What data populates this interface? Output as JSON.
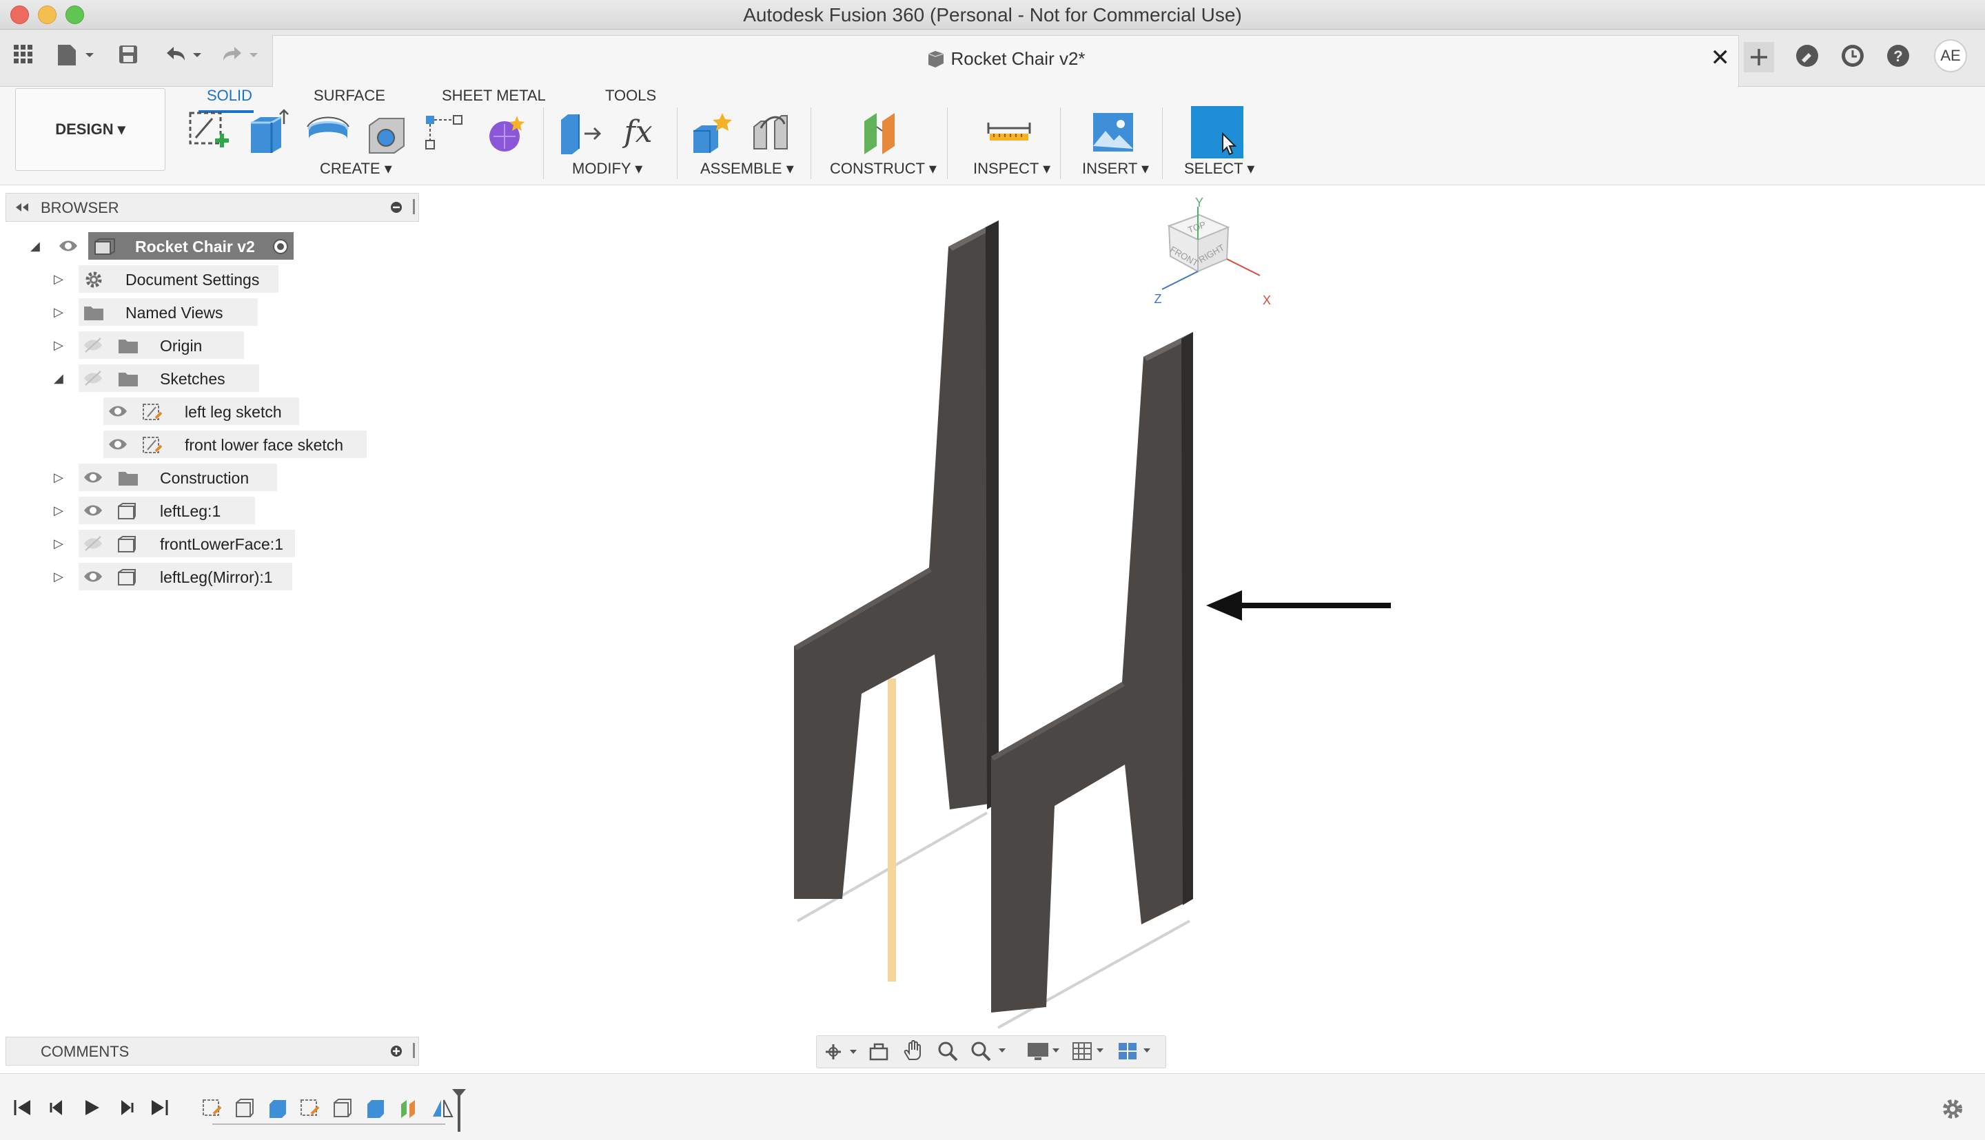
{
  "window": {
    "title": "Autodesk Fusion 360 (Personal - Not for Commercial Use)"
  },
  "document": {
    "title": "Rocket Chair v2*"
  },
  "user": {
    "initials": "AE"
  },
  "workspace": {
    "label": "DESIGN"
  },
  "tabs": [
    {
      "label": "SOLID",
      "active": true
    },
    {
      "label": "SURFACE"
    },
    {
      "label": "SHEET METAL"
    },
    {
      "label": "TOOLS"
    }
  ],
  "toolbar_groups": {
    "create": "CREATE",
    "modify": "MODIFY",
    "assemble": "ASSEMBLE",
    "construct": "CONSTRUCT",
    "inspect": "INSPECT",
    "insert": "INSERT",
    "select": "SELECT"
  },
  "browser": {
    "title": "BROWSER",
    "root": "Rocket Chair v2",
    "items": [
      {
        "label": "Document Settings"
      },
      {
        "label": "Named Views"
      },
      {
        "label": "Origin"
      },
      {
        "label": "Sketches"
      },
      {
        "label": "left leg sketch"
      },
      {
        "label": "front lower face sketch"
      },
      {
        "label": "Construction"
      },
      {
        "label": "leftLeg:1"
      },
      {
        "label": "frontLowerFace:1"
      },
      {
        "label": "leftLeg(Mirror):1"
      }
    ]
  },
  "comments": {
    "title": "COMMENTS"
  },
  "viewcube": {
    "top": "TOP",
    "front": "FRONT",
    "right": "RIGHT",
    "axis_x": "X",
    "axis_y": "Y",
    "axis_z": "Z"
  },
  "colors": {
    "accent": "#1a73c8",
    "select_blue": "#1e8fd6",
    "body_fill": "#4a4744",
    "sketch_line": "#f5d59a"
  }
}
